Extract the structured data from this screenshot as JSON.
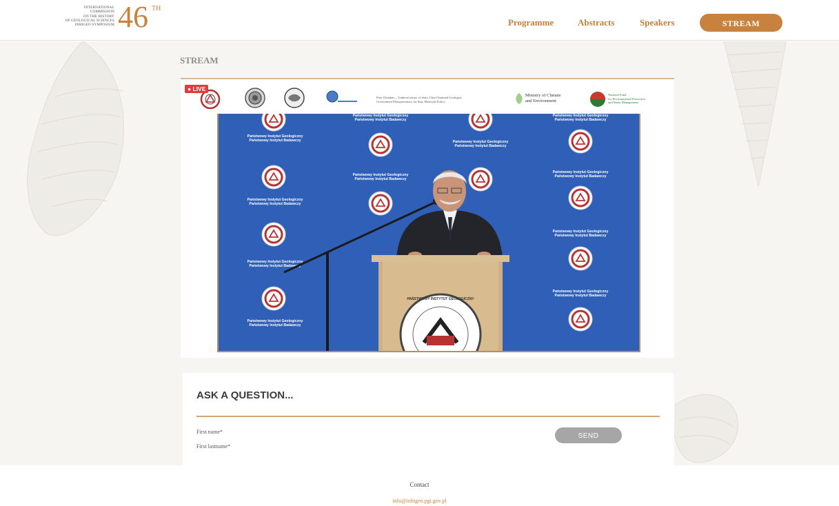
{
  "header": {
    "logo_lines": [
      "INTERNATIONAL",
      "COMMISSION",
      "ON THE HISTORY",
      "OF GEOLOGICAL SCIENCES",
      "INHIGEO SYMPOSIUM"
    ],
    "logo_number": "46",
    "logo_sup": "TH",
    "nav": {
      "programme": "Programme",
      "abstracts": "Abstracts",
      "speakers": "Speakers",
      "stream": "STREAM"
    }
  },
  "page": {
    "title": "STREAM"
  },
  "video": {
    "live_badge": "● LIVE",
    "sponsor_text_1": "Piotr Dziadzio – Undersecretary of State, Chief National Geologist,",
    "sponsor_text_2": "Government Plenipotentiary for Raw Materials Policy",
    "ministry": "Ministry of Climate",
    "ministry_2": "and Environment",
    "fund_text_1": "National Fund",
    "fund_text_2": "for Environmental Protection",
    "fund_text_3": "and Water Management",
    "backdrop_text_1": "Państwowy Instytut Geologiczny",
    "backdrop_text_2": "Państwowy Instytut Badawczy",
    "podium_seal": "PAŃSTWOWY INSTYTUT GEOLOGICZNY"
  },
  "question_form": {
    "heading": "ASK A QUESTION...",
    "first_name_label": "First name*",
    "last_name_label": "First lastname*",
    "send_label": "SEND"
  },
  "footer": {
    "contact": "Contact",
    "email": "info@inhigeo.pgi.gov.pl"
  },
  "colors": {
    "accent": "#c9823d",
    "backdrop_blue": "#2f5fb6",
    "button_grey": "#a6a6a6"
  }
}
